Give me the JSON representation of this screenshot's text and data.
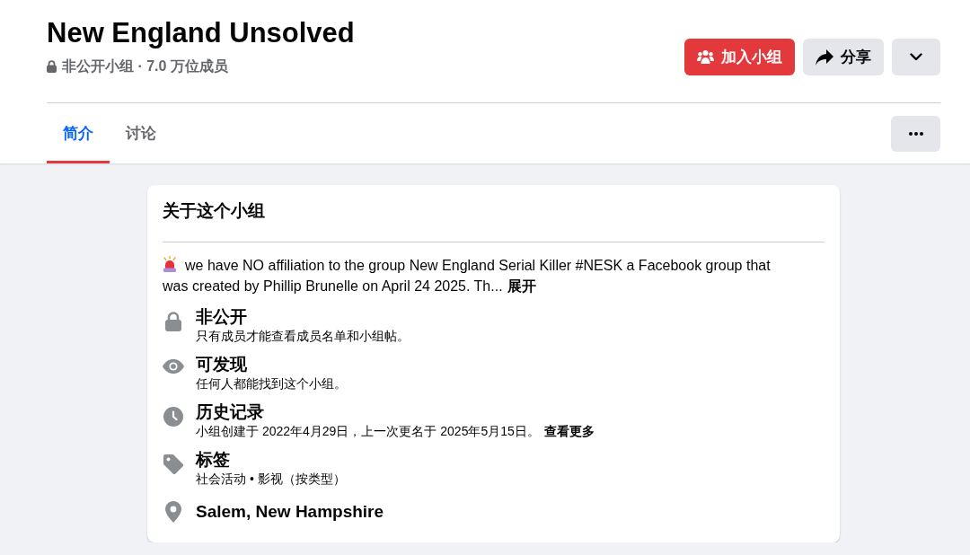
{
  "group": {
    "name": "New England Unsolved",
    "subtitle": "非公开小组 · 7.0 万位成员"
  },
  "actions": [
    {
      "kind": "join",
      "label": "加入小组"
    },
    {
      "kind": "share",
      "label": "分享"
    },
    {
      "kind": "menu"
    }
  ],
  "tabs": [
    {
      "label": "简介",
      "selected": true
    },
    {
      "label": "讨论",
      "selected": false
    }
  ],
  "about": {
    "title": "关于这个小组",
    "description": "we have NO affiliation to the group New England Serial Killer #NESK a Facebook group that was created by Phillip Brunelle on April 24 2025. Th...",
    "expand_link": "展开",
    "details": [
      {
        "kind": "privacy",
        "title": "非公开",
        "text": "只有成员才能查看成员名单和小组帖。"
      },
      {
        "kind": "visibility",
        "title": "可发现",
        "text": "任何人都能找到这个小组。"
      },
      {
        "kind": "history",
        "title": "历史记录",
        "text": "小组创建于 2022年4月29日，上一次更名于 2025年5月15日。",
        "link": "查看更多"
      },
      {
        "kind": "tags",
        "title": "标签",
        "text": "社会活动 • 影视（按类型）"
      },
      {
        "kind": "location",
        "title": "Salem, New Hampshire"
      }
    ]
  }
}
